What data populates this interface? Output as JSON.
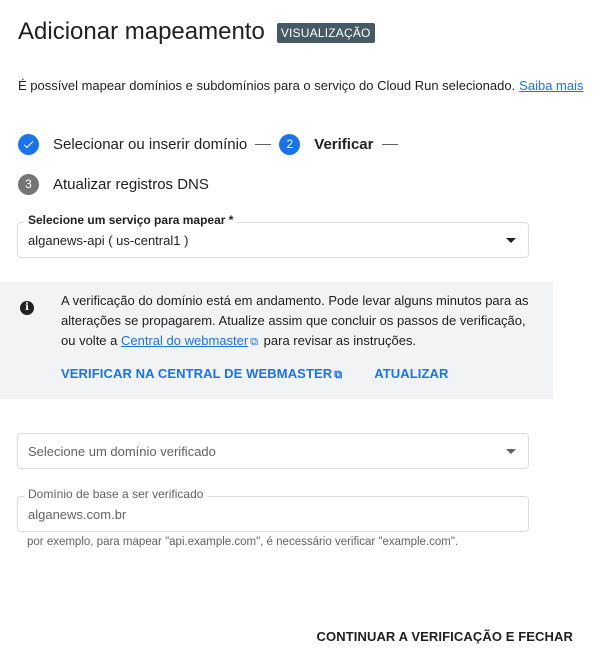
{
  "header": {
    "title": "Adicionar mapeamento",
    "badge": "VISUALIZAÇÃO"
  },
  "description": {
    "text": "É possível mapear domínios e subdomínios para o serviço do Cloud Run selecionado.",
    "link": "Saiba mais"
  },
  "stepper": {
    "steps": [
      {
        "label": "Selecionar ou inserir domínio",
        "state": "done",
        "icon": "check-icon"
      },
      {
        "label": "Verificar",
        "state": "active",
        "number": "2"
      },
      {
        "label": "Atualizar registros DNS",
        "state": "pending",
        "number": "3"
      }
    ]
  },
  "service_select": {
    "label": "Selecione um serviço para mapear *",
    "value": "alganews-api ( us-central1 )"
  },
  "info": {
    "icon": "info-icon",
    "text_before": "A verificação do domínio está em andamento. Pode levar alguns minutos para as alterações se propagarem. Atualize assim que concluir os passos de verificação, ou volte a",
    "link": "Central do webmaster",
    "text_after": "para revisar as instruções.",
    "verify_button": "VERIFICAR NA CENTRAL DE WEBMASTER",
    "refresh_button": "ATUALIZAR"
  },
  "verified_domain_select": {
    "placeholder": "Selecione um domínio verificado"
  },
  "base_domain_field": {
    "label": "Domínio de base a ser verificado",
    "value": "alganews.com.br",
    "helper": "por exemplo, para mapear \"api.example.com\", é necessário verificar \"example.com\"."
  },
  "footer": {
    "continue_button": "CONTINUAR A VERIFICAÇÃO E FECHAR"
  },
  "colors": {
    "primary": "#1a73e8",
    "badge_bg": "#455a64",
    "info_bg": "#f1f3f4",
    "pending_step": "#757575"
  }
}
